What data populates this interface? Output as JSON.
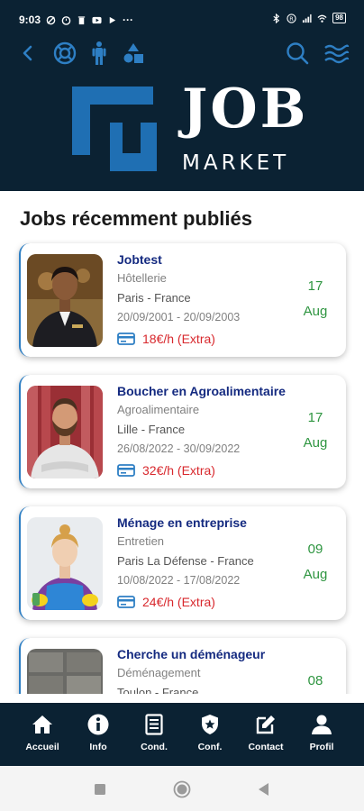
{
  "status_bar": {
    "time": "9:03",
    "battery": "98"
  },
  "brand": {
    "logo_word": "JOB",
    "logo_subword": "MARKET"
  },
  "colors": {
    "header_bg": "#0b2233",
    "accent_blue": "#2e7fc4",
    "title_navy": "#142a80",
    "pay_red": "#d8282d",
    "date_green": "#2e9540"
  },
  "section": {
    "title": "Jobs récemment publiés"
  },
  "jobs": [
    {
      "title": "Jobtest",
      "category": "Hôtellerie",
      "location": "Paris - France",
      "dates": "20/09/2001 - 20/09/2003",
      "pay": "18€/h (Extra)",
      "day": "17",
      "month": "Aug",
      "photo": "hotel-receptionist-photo"
    },
    {
      "title": "Boucher en Agroalimentaire",
      "category": "Agroalimentaire",
      "location": "Lille - France",
      "dates": "26/08/2022 - 30/09/2022",
      "pay": "32€/h (Extra)",
      "day": "17",
      "month": "Aug",
      "photo": "butcher-photo"
    },
    {
      "title": "Ménage en entreprise",
      "category": "Entretien",
      "location": "Paris La Défense - France",
      "dates": "10/08/2022 - 17/08/2022",
      "pay": "24€/h (Extra)",
      "day": "09",
      "month": "Aug",
      "photo": "cleaner-photo"
    },
    {
      "title": "Cherche un déménageur",
      "category": "Déménagement",
      "location": "Toulon - France",
      "dates": "",
      "pay": "",
      "day": "08",
      "month": "",
      "photo": "moving-boxes-photo"
    }
  ],
  "bottom_nav": [
    {
      "label": "Accueil",
      "icon": "home-icon"
    },
    {
      "label": "Info",
      "icon": "info-icon"
    },
    {
      "label": "Cond.",
      "icon": "document-icon"
    },
    {
      "label": "Conf.",
      "icon": "shield-star-icon"
    },
    {
      "label": "Contact",
      "icon": "edit-icon"
    },
    {
      "label": "Profil",
      "icon": "person-icon"
    }
  ]
}
